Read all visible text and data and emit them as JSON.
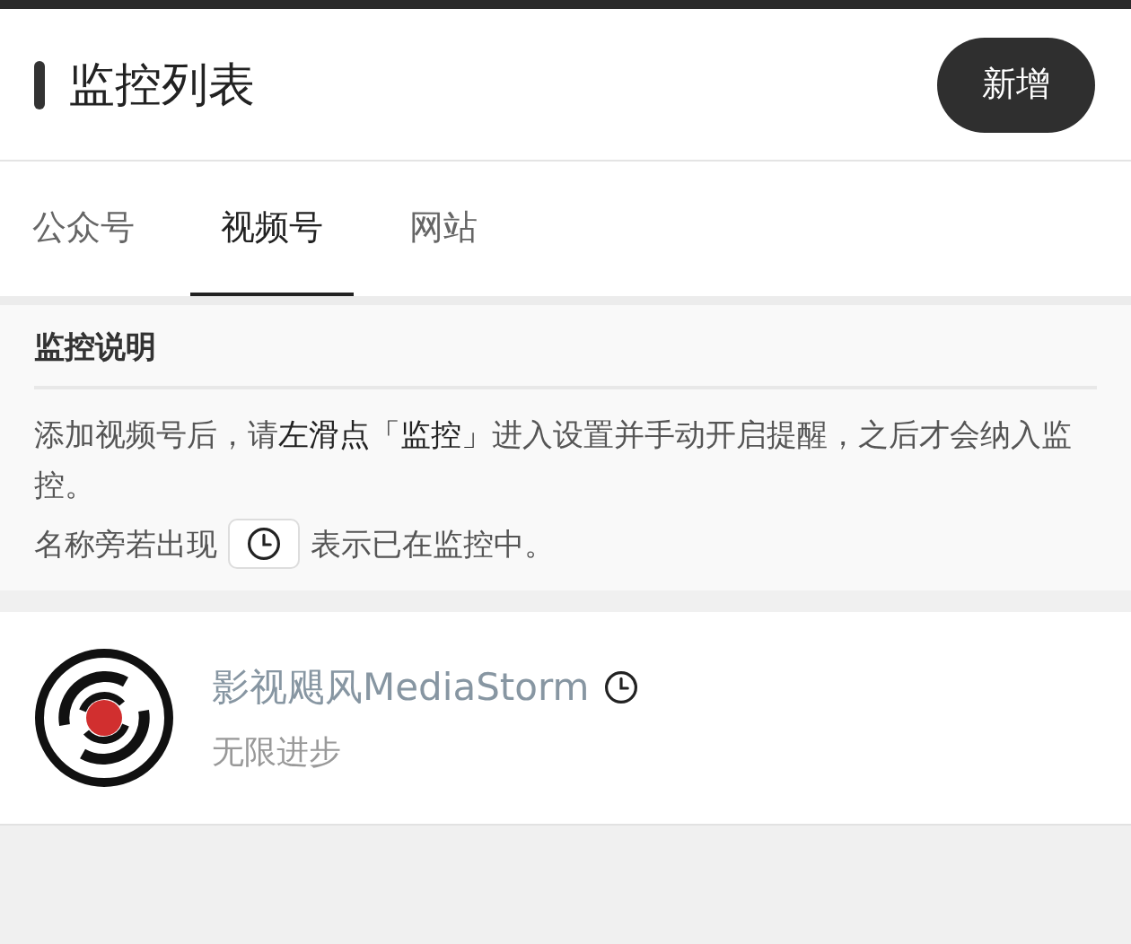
{
  "header": {
    "title": "监控列表",
    "add_button": "新增"
  },
  "tabs": [
    {
      "label": "公众号",
      "selected": false
    },
    {
      "label": "视频号",
      "selected": true
    },
    {
      "label": "网站",
      "selected": false
    }
  ],
  "notice": {
    "title": "监控说明",
    "text": "添加视频号后，请**左滑点「监控」**进入设置并手动开启提醒，之后才会纳入监控。",
    "legend_before": "名称旁若出现",
    "legend_after": "表示已在监控中。"
  },
  "accounts": [
    {
      "name": "影视飓风MediaStorm",
      "subtitle": "无限进步",
      "monitored": true
    }
  ]
}
